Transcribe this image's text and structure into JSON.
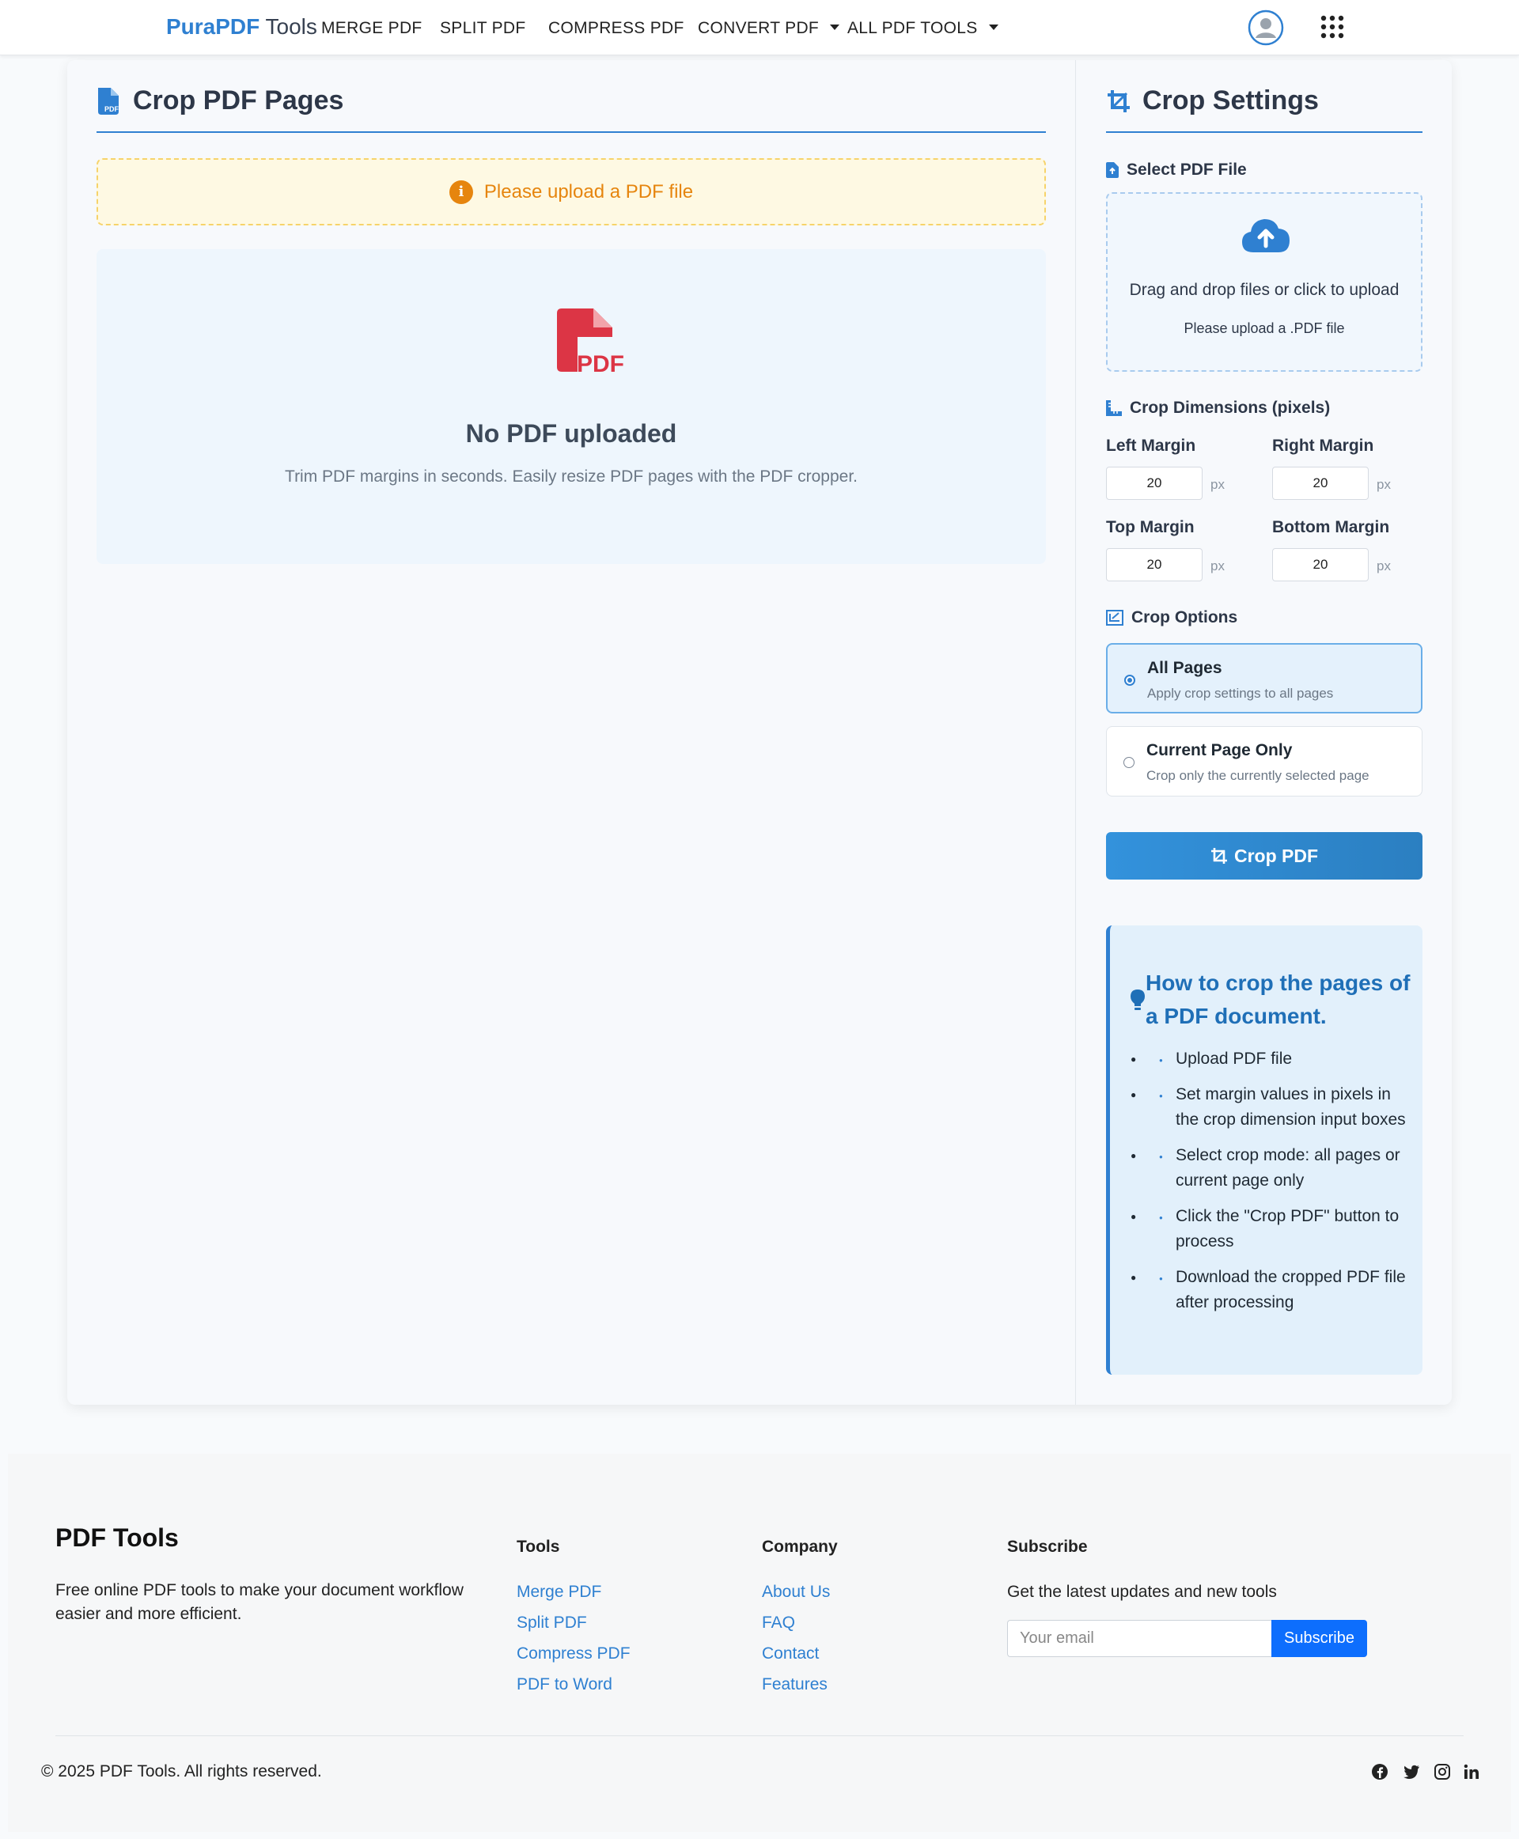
{
  "navbar": {
    "brand_primary": "PuraPDF",
    "brand_secondary": "Tools",
    "links": [
      "MERGE PDF",
      "SPLIT PDF",
      "COMPRESS PDF",
      "CONVERT PDF",
      "ALL PDF TOOLS"
    ],
    "icons": [
      "user-circle-icon",
      "apps-grid-icon"
    ]
  },
  "main": {
    "title": "Crop PDF Pages",
    "alert": "Please upload a PDF file",
    "empty_title": "No PDF uploaded",
    "empty_desc": "Trim PDF margins in seconds. Easily resize PDF pages with the PDF cropper."
  },
  "settings": {
    "title": "Crop Settings",
    "select_label": "Select PDF File",
    "drop_text": "Drag and drop files or click to upload",
    "drop_hint": "Please upload a .PDF file",
    "dimensions_label": "Crop Dimensions (pixels)",
    "fields": {
      "left": {
        "label": "Left Margin",
        "value": "20"
      },
      "right": {
        "label": "Right Margin",
        "value": "20"
      },
      "top": {
        "label": "Top Margin",
        "value": "20"
      },
      "bottom": {
        "label": "Bottom Margin",
        "value": "20"
      }
    },
    "unit": "px",
    "options_label": "Crop Options",
    "options": [
      {
        "title": "All Pages",
        "desc": "Apply crop settings to all pages",
        "selected": true
      },
      {
        "title": "Current Page Only",
        "desc": "Crop only the currently selected page",
        "selected": false
      }
    ],
    "crop_button": "Crop PDF",
    "howto": {
      "title": "How to crop the pages of a PDF document.",
      "steps": [
        "Upload PDF file",
        "Set margin values in pixels in the crop dimension input boxes",
        "Select crop mode: all pages or current page only",
        "Click the \"Crop PDF\" button to process",
        "Download the cropped PDF file after processing"
      ]
    }
  },
  "footer": {
    "brand": "PDF Tools",
    "desc": "Free online PDF tools to make your document workflow easier and more efficient.",
    "tools_head": "Tools",
    "tools": [
      "Merge PDF",
      "Split PDF",
      "Compress PDF",
      "PDF to Word"
    ],
    "company_head": "Company",
    "company": [
      "About Us",
      "FAQ",
      "Contact",
      "Features"
    ],
    "subscribe_head": "Subscribe",
    "subscribe_text": "Get the latest updates and new tools",
    "email_placeholder": "Your email",
    "subscribe_button": "Subscribe",
    "copyright": "© 2025 PDF Tools. All rights reserved.",
    "social": [
      "facebook-icon",
      "twitter-icon",
      "instagram-icon",
      "linkedin-icon"
    ]
  },
  "colors": {
    "accent": "#2f80d1",
    "alert_text": "#e6850e",
    "pdf_red": "#dc3545",
    "subscribe_blue": "#0d6efd"
  }
}
